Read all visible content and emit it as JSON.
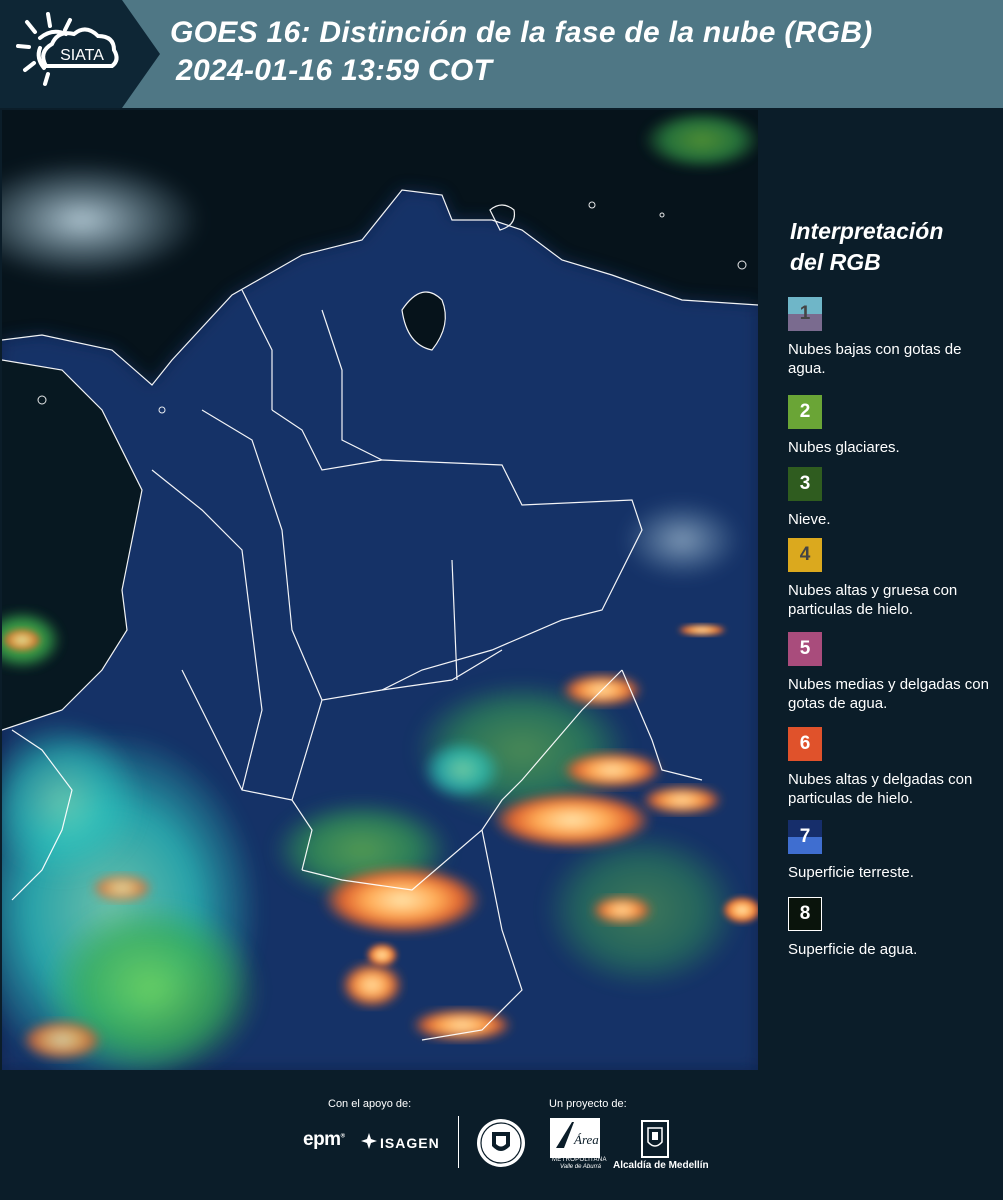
{
  "header": {
    "logo_text": "SIATA",
    "title_line1": "GOES 16: Distinción de la fase de la nube (RGB)",
    "title_line2": "2024-01-16 13:59 COT",
    "bg_color": "#4f7785"
  },
  "legend": {
    "title_line1": "Interpretación",
    "title_line2": "del RGB",
    "items": [
      {
        "number": "1",
        "label": "Nubes bajas con gotas de agua.",
        "color_top": "#6fb6c8",
        "color_bottom": "#7a6b8f",
        "text_color": "#444444"
      },
      {
        "number": "2",
        "label": "Nubes glaciares.",
        "color_top": "#6aa536",
        "color_bottom": "#6aa536",
        "text_color": "#ffffff"
      },
      {
        "number": "3",
        "label": "Nieve.",
        "color_top": "#2f5c1f",
        "color_bottom": "#2f5c1f",
        "text_color": "#ffffff"
      },
      {
        "number": "4",
        "label": "Nubes altas y gruesa con particulas de hielo.",
        "color_top": "#dba91e",
        "color_bottom": "#dba91e",
        "text_color": "#444444"
      },
      {
        "number": "5",
        "label": "Nubes medias y delgadas con gotas de agua.",
        "color_top": "#a94c7c",
        "color_bottom": "#a94c7c",
        "text_color": "#ffffff"
      },
      {
        "number": "6",
        "label": "Nubes altas y delgadas con particulas de hielo.",
        "color_top": "#e0522b",
        "color_bottom": "#e0522b",
        "text_color": "#ffffff"
      },
      {
        "number": "7",
        "label": "Superficie terreste.",
        "color_top": "#162e6b",
        "color_bottom": "#3f6ed0",
        "text_color": "#ffffff"
      },
      {
        "number": "8",
        "label": "Superficie de agua.",
        "color_top": "#0a140c",
        "color_bottom": "#0a140c",
        "text_color": "#ffffff"
      }
    ]
  },
  "footer": {
    "support_label": "Con el apoyo de:",
    "project_label": "Un proyecto de:",
    "epm": "epm",
    "isagen": "ISAGEN",
    "area_name": "Área",
    "area_sub1": "METROPOLITANA",
    "area_sub2": "Valle de Aburrá",
    "alcaldia": "Alcaldía de Medellín"
  }
}
